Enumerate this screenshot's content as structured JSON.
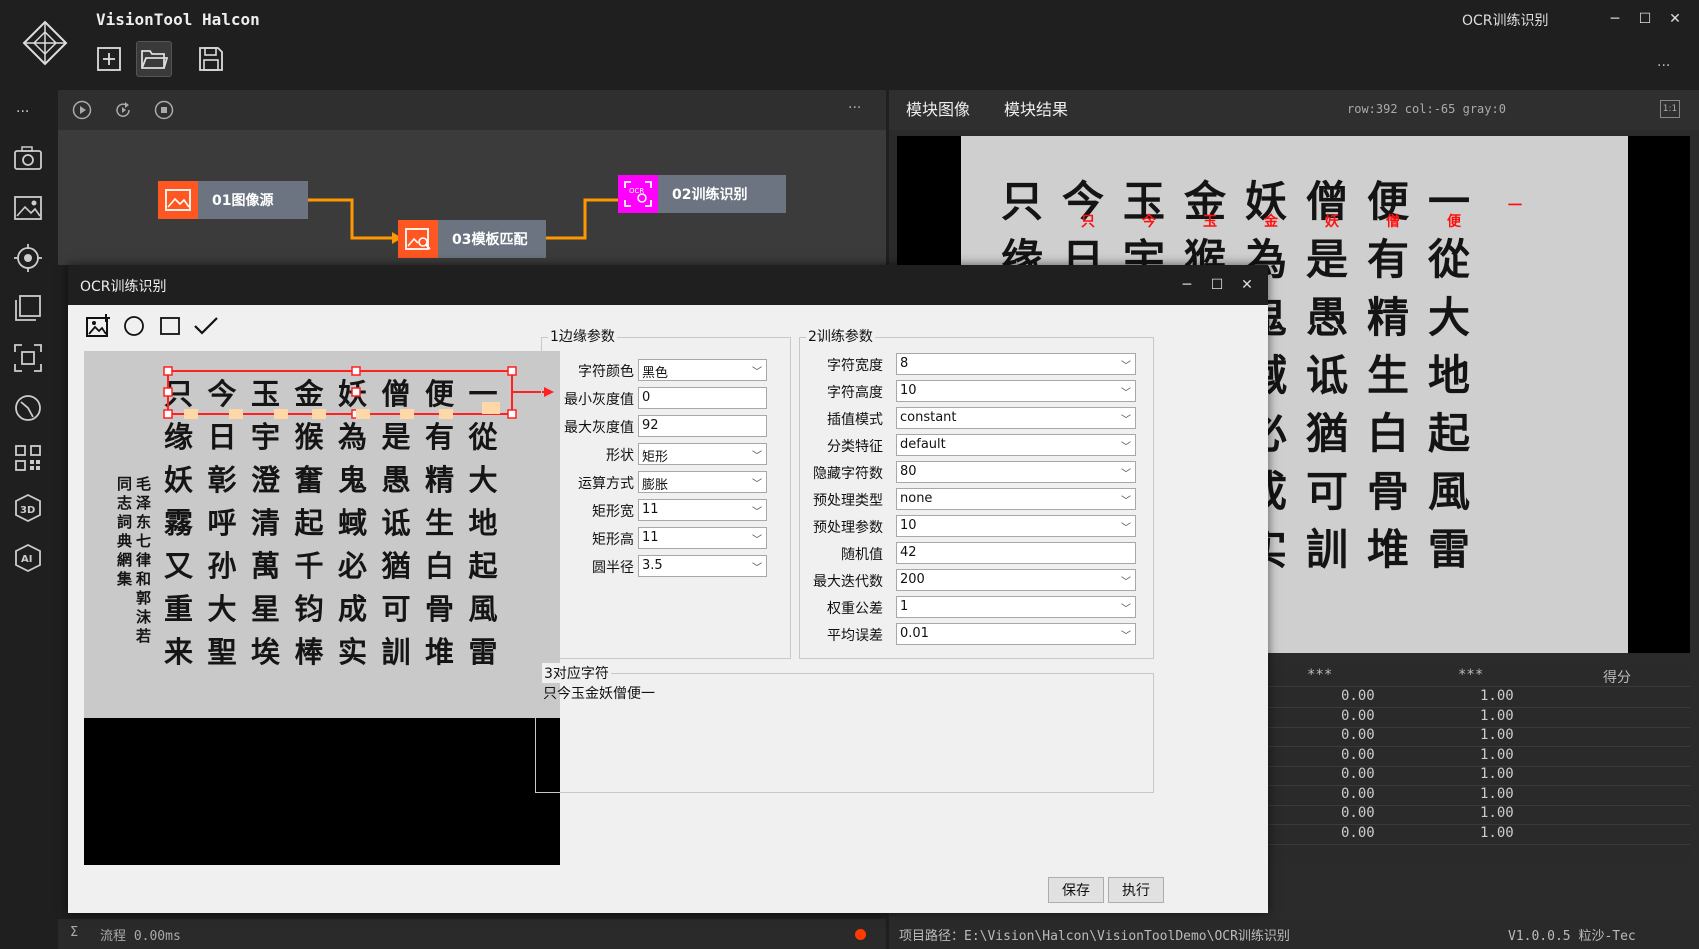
{
  "app": {
    "title": "VisionTool Halcon",
    "window_title": "OCR训练识别",
    "toolbar": [
      "new-file-icon",
      "open-folder-icon",
      "save-icon"
    ],
    "more": "...",
    "controls": {
      "min": "─",
      "max": "☐",
      "close": "✕"
    }
  },
  "leftrail": {
    "more": "...",
    "icons": [
      "camera-icon",
      "image-icon",
      "target-icon",
      "gallery-icon",
      "focus-icon",
      "measure-icon",
      "qrcode-icon",
      "3d-icon",
      "ai-icon"
    ]
  },
  "flow": {
    "toolbar_more": "...",
    "nodes": [
      {
        "label": "01图像源",
        "color": "#ff5722"
      },
      {
        "label": "03模板匹配",
        "color": "#ff5722"
      },
      {
        "label": "02训练识别",
        "color": "#ff00ff"
      }
    ],
    "arrow_color": "#ff9800"
  },
  "right_panel": {
    "tabs": [
      "模块图像",
      "模块结果"
    ],
    "coord_readout": "row:392 col:-65 gray:0",
    "zoom_label": "1:1",
    "image_rows": [
      "只今玉金妖僧便一",
      "缘日宇猴為是有從",
      "奮鬼愚精大",
      "起蜮诋生地",
      "千必猶白起",
      "钧成可骨風",
      "棒实訓堆雷"
    ],
    "red_labels": [
      "只",
      "今",
      "玉",
      "金",
      "妖",
      "僧",
      "便",
      "一"
    ],
    "table": {
      "headers": [
        "***",
        "***",
        "得分"
      ],
      "rows": [
        [
          "0.00",
          "0.00",
          "1.00"
        ],
        [
          "0.00",
          "0.00",
          "1.00"
        ],
        [
          "0.00",
          "0.00",
          "1.00"
        ],
        [
          "0.00",
          "0.00",
          "1.00"
        ],
        [
          "0.00",
          "0.00",
          "1.00"
        ],
        [
          "0.00",
          "0.00",
          "1.00"
        ],
        [
          "0.00",
          "0.00",
          "1.00"
        ],
        [
          "0.00",
          "0.00",
          "1.00"
        ]
      ]
    }
  },
  "status_left": {
    "sigma": "Σ",
    "label": "流程 0.00ms"
  },
  "status_right": {
    "path": "项目路径：E:\\Vision\\Halcon\\VisionToolDemo\\OCR训练识别",
    "version": "V1.0.0.5 粒沙-Tec"
  },
  "dialog": {
    "title": "OCR训练识别",
    "image_rows": [
      "只今玉金妖僧便一",
      "缘日宇猴為是有從",
      "妖彰澄奮鬼愚精大",
      "霧呼清起蜮诋生地",
      "又孙萬千必猶白起",
      "重大星钧成可骨風",
      "来聖埃棒实訓堆雷"
    ],
    "vertical_text_1": "毛泽东七律和郭沫若",
    "vertical_text_2": "同志詞典網集",
    "group1": {
      "title": "1边缘参数",
      "params": [
        {
          "label": "字符颜色",
          "value": "黑色",
          "dropdown": true
        },
        {
          "label": "最小灰度值",
          "value": "0",
          "dropdown": false
        },
        {
          "label": "最大灰度值",
          "value": "92",
          "dropdown": false
        },
        {
          "label": "形状",
          "value": "矩形",
          "dropdown": true
        },
        {
          "label": "运算方式",
          "value": "膨胀",
          "dropdown": true
        },
        {
          "label": "矩形宽",
          "value": "11",
          "dropdown": true
        },
        {
          "label": "矩形高",
          "value": "11",
          "dropdown": true
        },
        {
          "label": "圆半径",
          "value": "3.5",
          "dropdown": true
        }
      ]
    },
    "group2": {
      "title": "2训练参数",
      "params": [
        {
          "label": "字符宽度",
          "value": "8",
          "dropdown": true
        },
        {
          "label": "字符高度",
          "value": "10",
          "dropdown": true
        },
        {
          "label": "插值模式",
          "value": "constant",
          "dropdown": true
        },
        {
          "label": "分类特征",
          "value": "default",
          "dropdown": true
        },
        {
          "label": "隐藏字符数",
          "value": "80",
          "dropdown": true
        },
        {
          "label": "预处理类型",
          "value": "none",
          "dropdown": true
        },
        {
          "label": "预处理参数",
          "value": "10",
          "dropdown": true
        },
        {
          "label": "随机值",
          "value": "42",
          "dropdown": false
        },
        {
          "label": "最大迭代数",
          "value": "200",
          "dropdown": true
        },
        {
          "label": "权重公差",
          "value": "1",
          "dropdown": true
        },
        {
          "label": "平均误差",
          "value": "0.01",
          "dropdown": true
        }
      ]
    },
    "group3": {
      "title": "3对应字符",
      "value": "只今玉金妖僧便一"
    },
    "buttons": {
      "save": "保存",
      "run": "执行"
    }
  }
}
